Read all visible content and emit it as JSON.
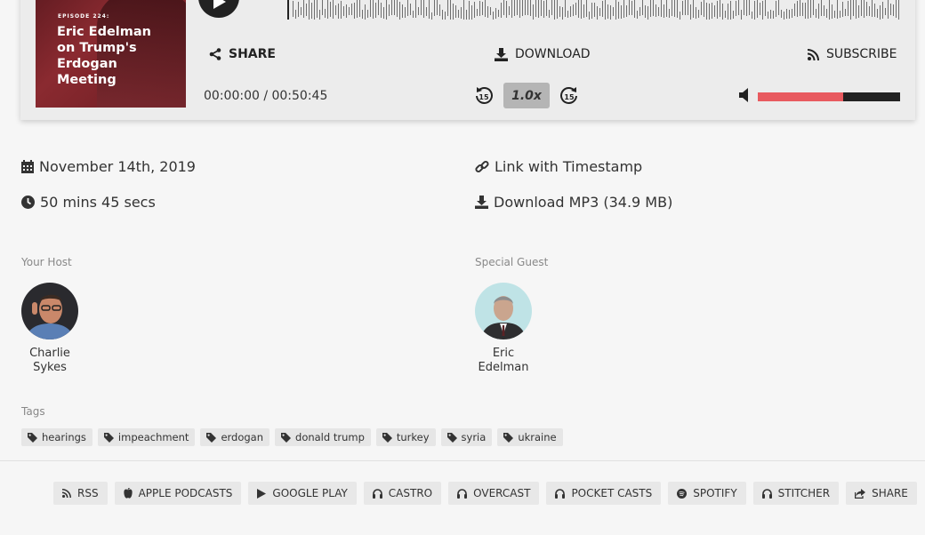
{
  "player": {
    "cover": {
      "episode": "EPISODE 224:",
      "title": "Eric Edelman on Trump's Erdogan Meeting"
    },
    "share_label": "SHARE",
    "download_label": "DOWNLOAD",
    "subscribe_label": "SUBSCRIBE",
    "time": "00:00:00 / 00:50:45",
    "speed": "1.0x",
    "skip_back_seconds": "15",
    "skip_forward_seconds": "15",
    "volume_level": 0.6,
    "colors": {
      "volume_fill": "#e85a5f",
      "volume_track": "#222222",
      "speed_bg": "#b5b5b5"
    }
  },
  "meta": {
    "date": "November 14th, 2019",
    "duration": "50 mins 45 secs",
    "link_timestamp": "Link with Timestamp",
    "download_mp3": "Download MP3 (34.9 MB)"
  },
  "host": {
    "label": "Your Host",
    "first": "Charlie",
    "last": "Sykes"
  },
  "guest": {
    "label": "Special Guest",
    "first": "Eric",
    "last": "Edelman"
  },
  "tags": {
    "label": "Tags",
    "items": [
      "hearings",
      "impeachment",
      "erdogan",
      "donald trump",
      "turkey",
      "syria",
      "ukraine"
    ]
  },
  "subscribe_links": [
    {
      "icon": "rss-icon",
      "label": "RSS"
    },
    {
      "icon": "apple-icon",
      "label": "APPLE PODCASTS"
    },
    {
      "icon": "play-icon",
      "label": "GOOGLE PLAY"
    },
    {
      "icon": "headphones-icon",
      "label": "CASTRO"
    },
    {
      "icon": "headphones-icon",
      "label": "OVERCAST"
    },
    {
      "icon": "headphones-icon",
      "label": "POCKET CASTS"
    },
    {
      "icon": "spotify-icon",
      "label": "SPOTIFY"
    },
    {
      "icon": "headphones-icon",
      "label": "STITCHER"
    },
    {
      "icon": "share-icon",
      "label": "SHARE"
    }
  ]
}
